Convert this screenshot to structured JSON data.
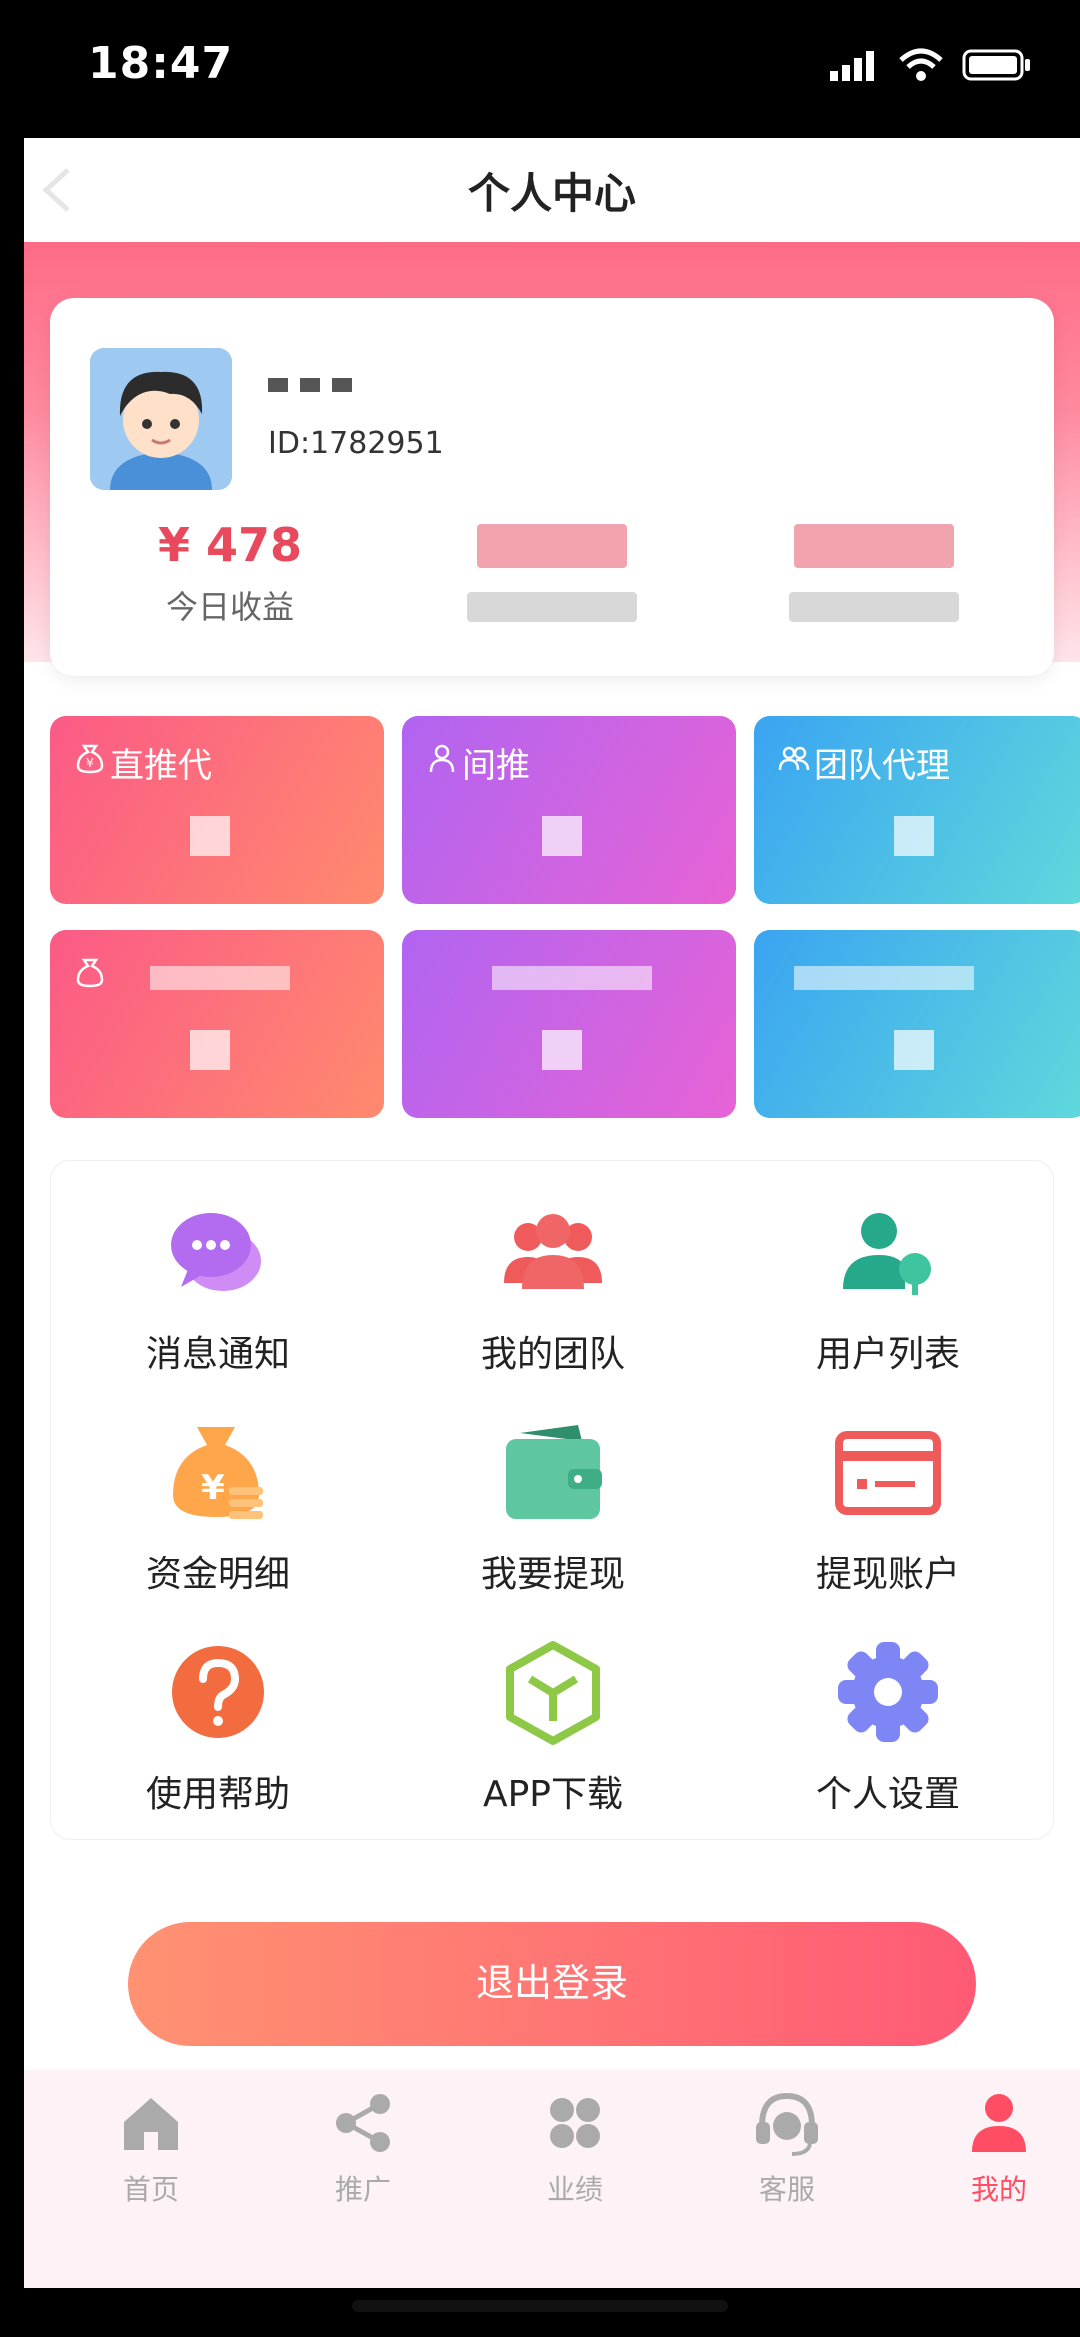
{
  "status_bar": {
    "time": "18:47"
  },
  "nav": {
    "title": "个人中心"
  },
  "profile": {
    "id_text": "ID:1782951",
    "stats": [
      {
        "value": "¥ 478",
        "label": "今日收益"
      }
    ]
  },
  "tiles": {
    "row1": [
      {
        "title": "直推代",
        "icon": "money-bag-icon"
      },
      {
        "title": "间推",
        "icon": "user-icon"
      },
      {
        "title": "团队代理",
        "icon": "team-icon"
      }
    ]
  },
  "menu": {
    "items": [
      {
        "label": "消息通知",
        "icon": "chat-bubble-icon",
        "color": "#b36cf0"
      },
      {
        "label": "我的团队",
        "icon": "team-icon",
        "color": "#ef5a5a"
      },
      {
        "label": "用户列表",
        "icon": "user-list-icon",
        "color": "#26a88a"
      },
      {
        "label": "资金明细",
        "icon": "money-bag-icon",
        "color": "#ffa54a"
      },
      {
        "label": "我要提现",
        "icon": "wallet-icon",
        "color": "#5fc7a0"
      },
      {
        "label": "提现账户",
        "icon": "card-icon",
        "color": "#ef5a5a"
      },
      {
        "label": "使用帮助",
        "icon": "help-icon",
        "color": "#f36c3f"
      },
      {
        "label": "APP下载",
        "icon": "box-icon",
        "color": "#8dc847"
      },
      {
        "label": "个人设置",
        "icon": "gear-icon",
        "color": "#7e86f5"
      }
    ]
  },
  "logout": {
    "label": "退出登录"
  },
  "tabs": [
    {
      "label": "首页",
      "icon": "home-icon"
    },
    {
      "label": "推广",
      "icon": "share-icon"
    },
    {
      "label": "业绩",
      "icon": "grid-icon"
    },
    {
      "label": "客服",
      "icon": "headset-icon"
    },
    {
      "label": "我的",
      "icon": "profile-icon",
      "active": true
    }
  ],
  "colors": {
    "accent": "#ff4d63",
    "brand_pink": "#ff6b86"
  }
}
